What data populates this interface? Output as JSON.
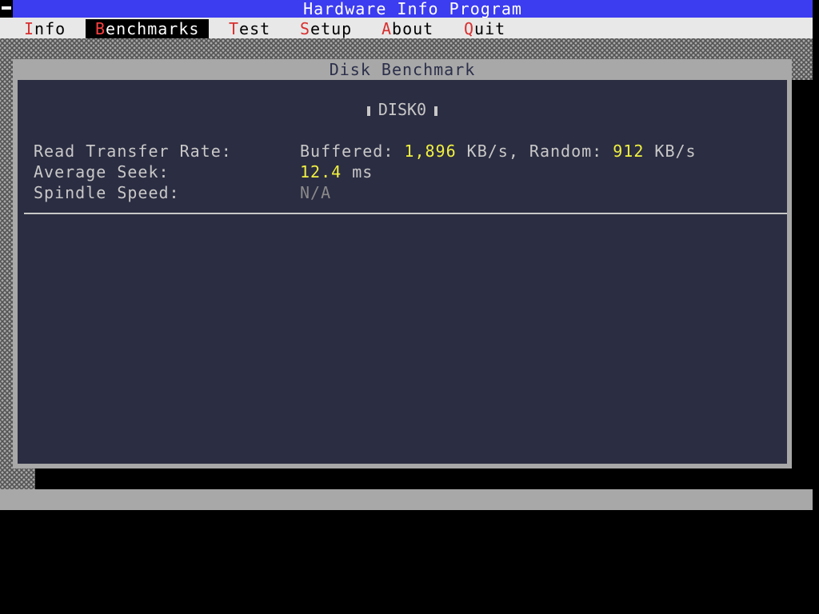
{
  "app": {
    "title": "Hardware Info Program"
  },
  "menu": {
    "items": [
      {
        "hotkey": "I",
        "rest": "nfo"
      },
      {
        "hotkey": "B",
        "rest": "enchmarks"
      },
      {
        "hotkey": "T",
        "rest": "est"
      },
      {
        "hotkey": "S",
        "rest": "etup"
      },
      {
        "hotkey": "A",
        "rest": "bout"
      },
      {
        "hotkey": "Q",
        "rest": "uit"
      }
    ],
    "active": "Benchmarks"
  },
  "window": {
    "title": "Disk Benchmark",
    "disk_name": "DISK0"
  },
  "stats": {
    "read_transfer": {
      "label": "Read Transfer Rate:",
      "buffered_label": "Buffered: ",
      "buffered_value": "1,896",
      "buffered_unit": " KB/s, Random: ",
      "random_value": "912",
      "random_unit": " KB/s"
    },
    "average_seek": {
      "label": "Average Seek:",
      "value": "12.4",
      "unit": " ms"
    },
    "spindle_speed": {
      "label": "Spindle Speed:",
      "value": "N/A"
    }
  },
  "colors": {
    "titlebar": "#3c3cf0",
    "menubar": "#e8e8e8",
    "hotkey": "#d83030",
    "window_frame": "#a8a8a8",
    "window_body": "#2b2d42",
    "highlight_value": "#f0f040"
  }
}
